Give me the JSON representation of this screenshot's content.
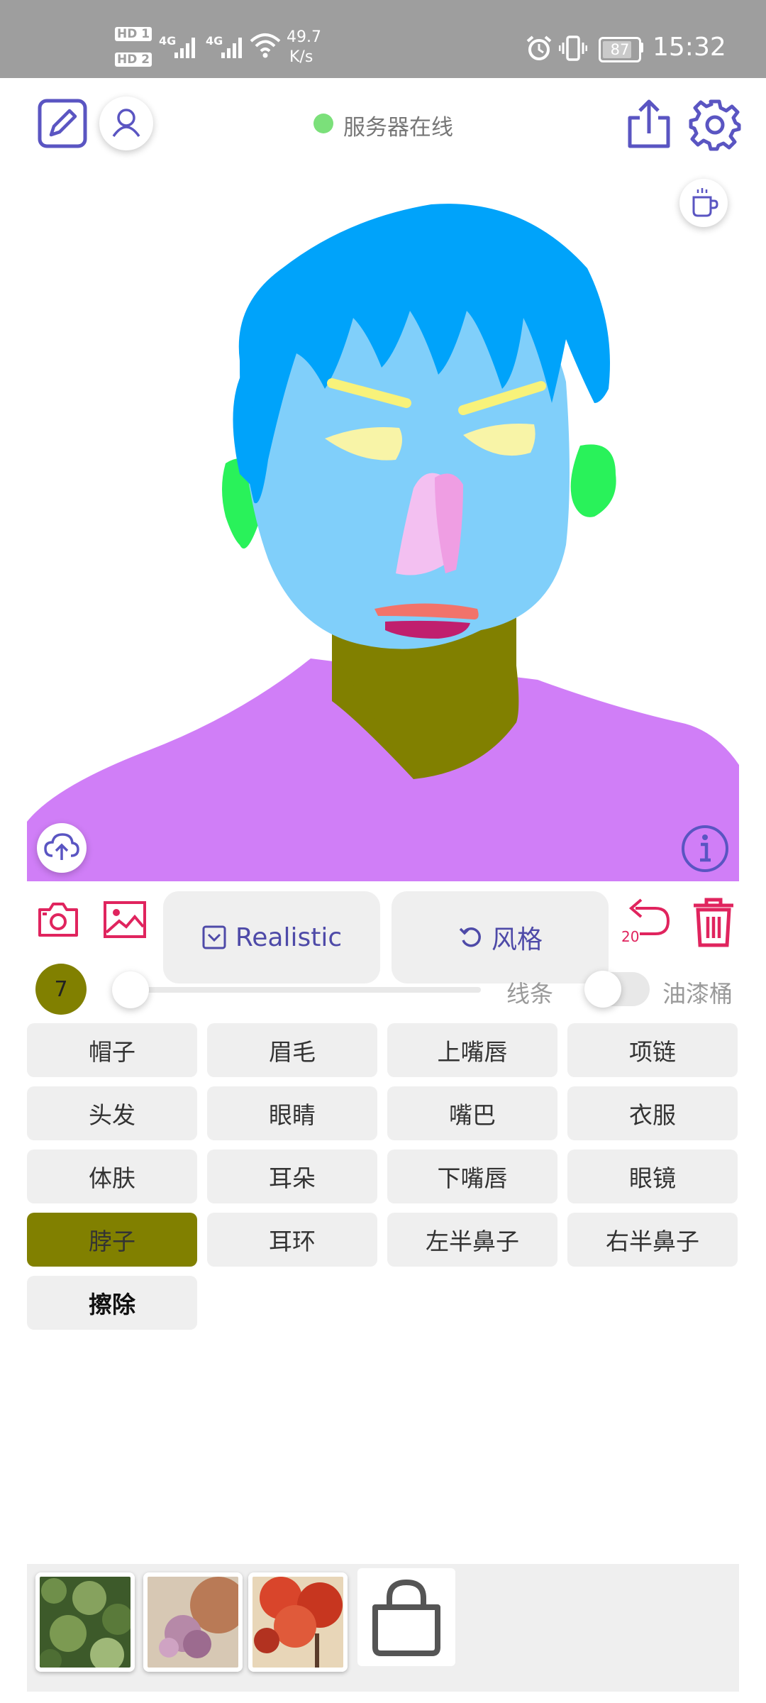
{
  "status_bar": {
    "hd1": "HD 1",
    "hd2": "HD 2",
    "net1": "4G",
    "net2": "4G",
    "speed_value": "49.7",
    "speed_unit": "K/s",
    "battery": "87",
    "time": "15:32"
  },
  "header": {
    "server_status": "服务器在线",
    "server_status_color": "#7be07a",
    "accent": "#5a55c2"
  },
  "toolbar": {
    "style_button": "Realistic",
    "theme_button": "风格",
    "undo_count": "20",
    "brush_size": "7",
    "brush_color": "#818000",
    "slider_fraction": 0.05,
    "lines_label": "线条",
    "paint_bucket_label": "油漆桶",
    "danger_color": "#e0245e"
  },
  "labels": [
    {
      "text": "帽子",
      "selected": false
    },
    {
      "text": "眉毛",
      "selected": false
    },
    {
      "text": "上嘴唇",
      "selected": false
    },
    {
      "text": "项链",
      "selected": false
    },
    {
      "text": "头发",
      "selected": false
    },
    {
      "text": "眼睛",
      "selected": false
    },
    {
      "text": "嘴巴",
      "selected": false
    },
    {
      "text": "衣服",
      "selected": false
    },
    {
      "text": "体肤",
      "selected": false
    },
    {
      "text": "耳朵",
      "selected": false
    },
    {
      "text": "下嘴唇",
      "selected": false
    },
    {
      "text": "眼镜",
      "selected": false
    },
    {
      "text": "脖子",
      "selected": true
    },
    {
      "text": "耳环",
      "selected": false
    },
    {
      "text": "左半鼻子",
      "selected": false
    },
    {
      "text": "右半鼻子",
      "selected": false
    },
    {
      "text": "擦除",
      "selected": false
    }
  ],
  "gallery": {
    "items": [
      "green-foliage-thumbnail",
      "pink-flower-thumbnail",
      "red-tree-thumbnail",
      "store-bag-icon"
    ]
  }
}
